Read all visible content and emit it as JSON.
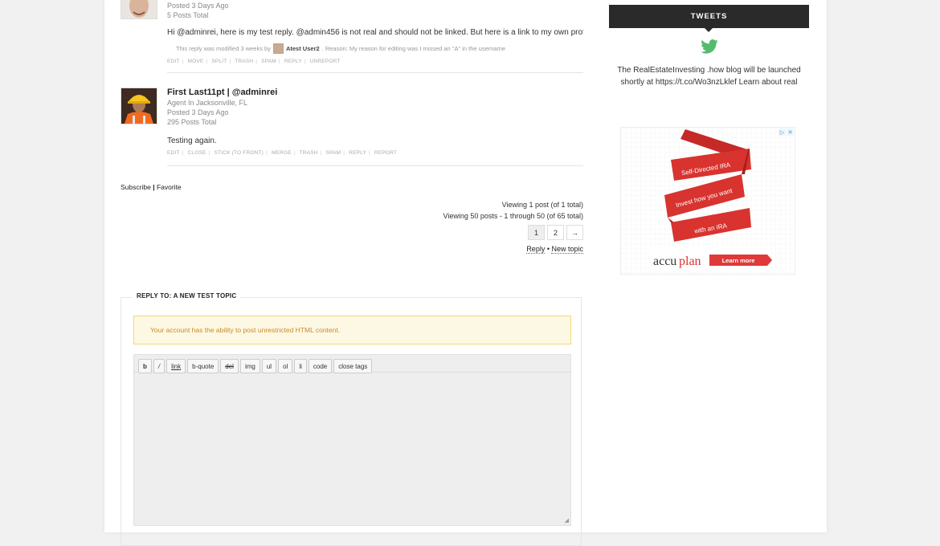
{
  "posts": [
    {
      "posted": "Posted 3 Days Ago",
      "total": "5 Posts Total",
      "content": "Hi @adminrei, here is my test reply. @admin456 is not real and should not be linked. But here is a link to my own profile",
      "modified_prefix": "This reply was modified 3 weeks by",
      "modified_user": "Atest User2",
      "modified_reason": ". Reason: My reason for editing was I missed an \"A\" in the username",
      "admin_links": [
        "EDIT",
        "MOVE",
        "SPLIT",
        "TRASH",
        "SPAM",
        "REPLY",
        "UNREPORT"
      ]
    },
    {
      "author": "First Last11pt | @adminrei",
      "location": "Agent In Jacksonville, FL",
      "posted": "Posted 3 Days Ago",
      "total": "295 Posts Total",
      "content": "Testing again.",
      "admin_links": [
        "EDIT",
        "CLOSE",
        "STICK (TO FRONT)",
        "MERGE",
        "TRASH",
        "SPAM",
        "REPLY",
        "REPORT"
      ]
    }
  ],
  "subscribe": {
    "subscribe": "Subscribe",
    "sep": "|",
    "favorite": "Favorite"
  },
  "pagination": {
    "viewing_post": "Viewing 1 post (of 1 total)",
    "viewing_posts": "Viewing 50 posts - 1 through 50 (of 65 total)",
    "pages": [
      "1",
      "2",
      "→"
    ]
  },
  "reply_links": {
    "reply": "Reply",
    "sep": " • ",
    "new_topic": "New topic"
  },
  "reply_form": {
    "legend": "REPLY TO: A NEW TEST TOPIC",
    "notice": "Your account has the ability to post unrestricted HTML content.",
    "toolbar": [
      "b",
      "/",
      "link",
      "b-quote",
      "del",
      "img",
      "ul",
      "ol",
      "li",
      "code",
      "close tags"
    ],
    "resize_glyph": "◢"
  },
  "sidebar": {
    "tweets_title": "TWEETS",
    "tweet_text": "The RealEstateInvesting .how blog will be launched shortly at https://t.co/Wo3nzLklef Learn about real",
    "ad": {
      "ribbon1": "Self-Directed IRA",
      "ribbon2": "Invest how you want",
      "ribbon3": "with an IRA",
      "brand1": "accu",
      "brand2": "plan",
      "cta": "Learn more",
      "badge_play": "▷",
      "badge_close": "✕"
    }
  },
  "colors": {
    "accent_red": "#d8332f",
    "twitter": "#55bb6f",
    "notice_bg": "#fdf8e3"
  }
}
